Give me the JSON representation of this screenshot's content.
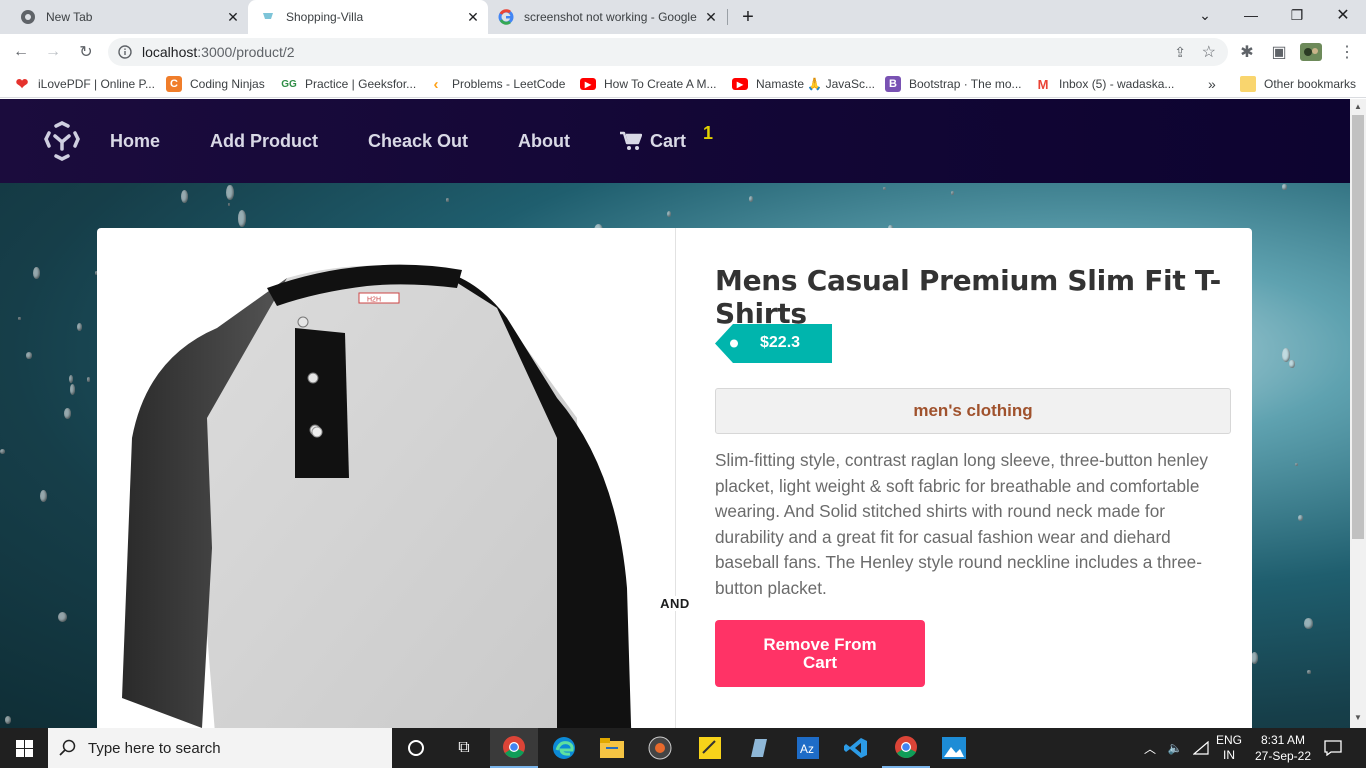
{
  "browser": {
    "tabs": [
      {
        "title": "New Tab",
        "icon": "chrome-icon",
        "active": false
      },
      {
        "title": "Shopping-Villa",
        "icon": "shop-favicon-icon",
        "active": true
      },
      {
        "title": "screenshot not working - Google",
        "icon": "google-icon",
        "active": false
      }
    ],
    "new_tab_symbol": "+",
    "url_host": "localhost",
    "url_path": ":3000/product/2",
    "bookmarks": [
      {
        "label": "iLovePDF | Online P...",
        "icon": "heart-icon",
        "color": "#e5322d"
      },
      {
        "label": "Coding Ninjas",
        "icon": "coding-ninjas-icon",
        "color": "#f07d2a"
      },
      {
        "label": "Practice | Geeksfor...",
        "icon": "gfg-icon",
        "color": "#2f8d46"
      },
      {
        "label": "Problems - LeetCode",
        "icon": "leetcode-icon",
        "color": "#ffa116"
      },
      {
        "label": "How To Create A M...",
        "icon": "youtube-icon",
        "color": "#ff0000"
      },
      {
        "label": "Namaste 🙏 JavaSc...",
        "icon": "youtube-icon",
        "color": "#ff0000"
      },
      {
        "label": "Bootstrap · The mo...",
        "icon": "bootstrap-icon",
        "color": "#7952b3"
      },
      {
        "label": "Inbox (5) - wadaska...",
        "icon": "gmail-icon",
        "color": "#ea4335"
      }
    ],
    "more_bookmarks": "»",
    "other_bookmarks": "Other bookmarks"
  },
  "navbar": {
    "items": [
      "Home",
      "Add Product",
      "Cheack Out",
      "About"
    ],
    "cart_label": "Cart",
    "cart_count": "1"
  },
  "product": {
    "title": "Mens Casual Premium Slim Fit T-Shirts",
    "price": "$22.3",
    "category": "men's clothing",
    "description": "Slim-fitting style, contrast raglan long sleeve, three-button henley placket, light weight & soft fabric for breathable and comfortable wearing. And Solid stitched shirts with round neck made for durability and a great fit for casual fashion wear and diehard baseball fans. The Henley style round neckline includes a three-button placket.",
    "divider_label": "AND",
    "remove_button": "Remove From Cart",
    "tag_label": "H2H"
  },
  "colors": {
    "navbar": "#170a3a",
    "price_tag": "#00b5ad",
    "remove_button": "#ff3366",
    "category_text": "#a0522d",
    "cart_badge": "#e0d000"
  },
  "taskbar": {
    "search_placeholder": "Type here to search",
    "language_top": "ENG",
    "language_bottom": "IN",
    "time": "8:31 AM",
    "date": "27-Sep-22"
  }
}
